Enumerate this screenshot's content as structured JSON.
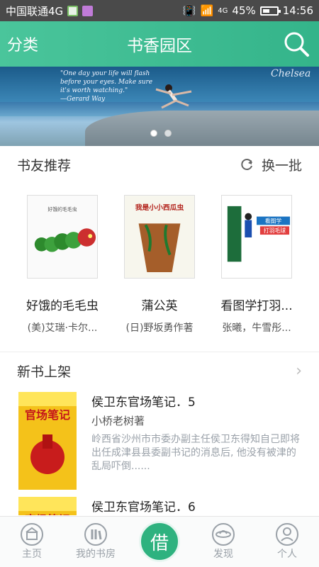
{
  "status": {
    "carrier": "中国联通4G",
    "signal_label": "4G",
    "battery": "45%",
    "time": "14:56"
  },
  "topbar": {
    "left": "分类",
    "title": "书香园区"
  },
  "banner": {
    "quote_lines": [
      "\"One day your life will flash",
      "before your eyes. Make sure",
      "it's worth watching.\"",
      "—Gerard Way"
    ],
    "logo": "Chelsea"
  },
  "recommend": {
    "title": "书友推荐",
    "refresh_label": "换一批",
    "books": [
      {
        "name": "好饿的毛毛虫",
        "author": "(美)艾瑞·卡尔..."
      },
      {
        "name": "蒲公英",
        "author": "(日)野坂勇作著"
      },
      {
        "name": "看图学打羽...",
        "author": "张曦，牛雪彤..."
      }
    ]
  },
  "new_books": {
    "title": "新书上架",
    "items": [
      {
        "title": "侯卫东官场笔记．5",
        "author": "小桥老树著",
        "desc": "岭西省沙州市市委办副主任侯卫东得知自己即将出任成津县县委副书记的消息后, 他没有被津的乱局吓倒......"
      },
      {
        "title": "侯卫东官场笔记．6",
        "author": "",
        "desc": ""
      }
    ]
  },
  "nav": {
    "home": "主页",
    "shelf": "我的书房",
    "borrow": "借",
    "discover": "发现",
    "profile": "个人"
  }
}
